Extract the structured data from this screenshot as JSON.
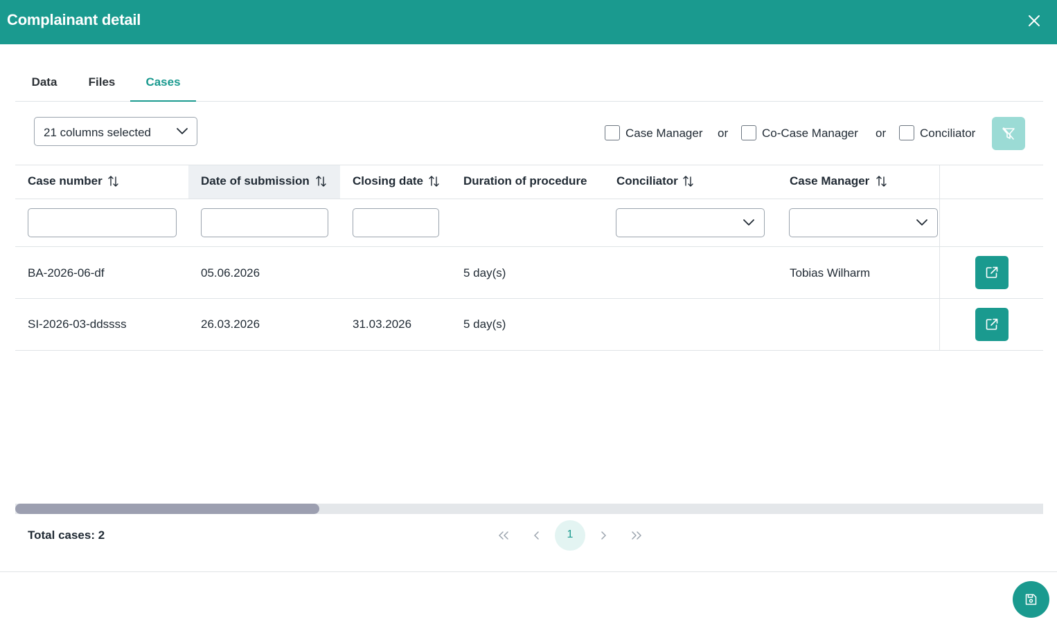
{
  "dialog": {
    "title": "Complainant detail"
  },
  "tabs": [
    {
      "label": "Data",
      "active": false
    },
    {
      "label": "Files",
      "active": false
    },
    {
      "label": "Cases",
      "active": true
    }
  ],
  "column_selector": {
    "value": "21 columns selected"
  },
  "role_filters": {
    "options": [
      {
        "label": "Case Manager",
        "checked": false
      },
      {
        "label": "Co-Case Manager",
        "checked": false
      },
      {
        "label": "Conciliator",
        "checked": false
      }
    ],
    "separator": "or"
  },
  "table": {
    "columns": [
      {
        "label": "Case number",
        "sortable": true
      },
      {
        "label": "Date of submission",
        "sortable": true,
        "highlighted": true
      },
      {
        "label": "Closing date",
        "sortable": true
      },
      {
        "label": "Duration of procedure",
        "sortable": false
      },
      {
        "label": "Conciliator",
        "sortable": true
      },
      {
        "label": "Case Manager",
        "sortable": true
      }
    ],
    "rows": [
      {
        "case_number": "BA-2026-06-df",
        "date_of_submission": "05.06.2026",
        "closing_date": "",
        "duration": "5 day(s)",
        "conciliator": "",
        "case_manager": "Tobias Wilharm"
      },
      {
        "case_number": "SI-2026-03-ddssss",
        "date_of_submission": "26.03.2026",
        "closing_date": "31.03.2026",
        "duration": "5 day(s)",
        "conciliator": "",
        "case_manager": ""
      }
    ]
  },
  "pagination": {
    "total_label": "Total cases: 2",
    "current_page": "1"
  },
  "colors": {
    "accent": "#1a9a8f",
    "accent_light": "#9bdbd5",
    "page_highlight": "#e3f4f2"
  },
  "icons": [
    "close-icon",
    "chevron-down-icon",
    "sort-icon",
    "filter-clear-icon",
    "external-link-icon",
    "double-chevron-left-icon",
    "chevron-left-icon",
    "chevron-right-icon",
    "double-chevron-right-icon",
    "save-icon"
  ]
}
